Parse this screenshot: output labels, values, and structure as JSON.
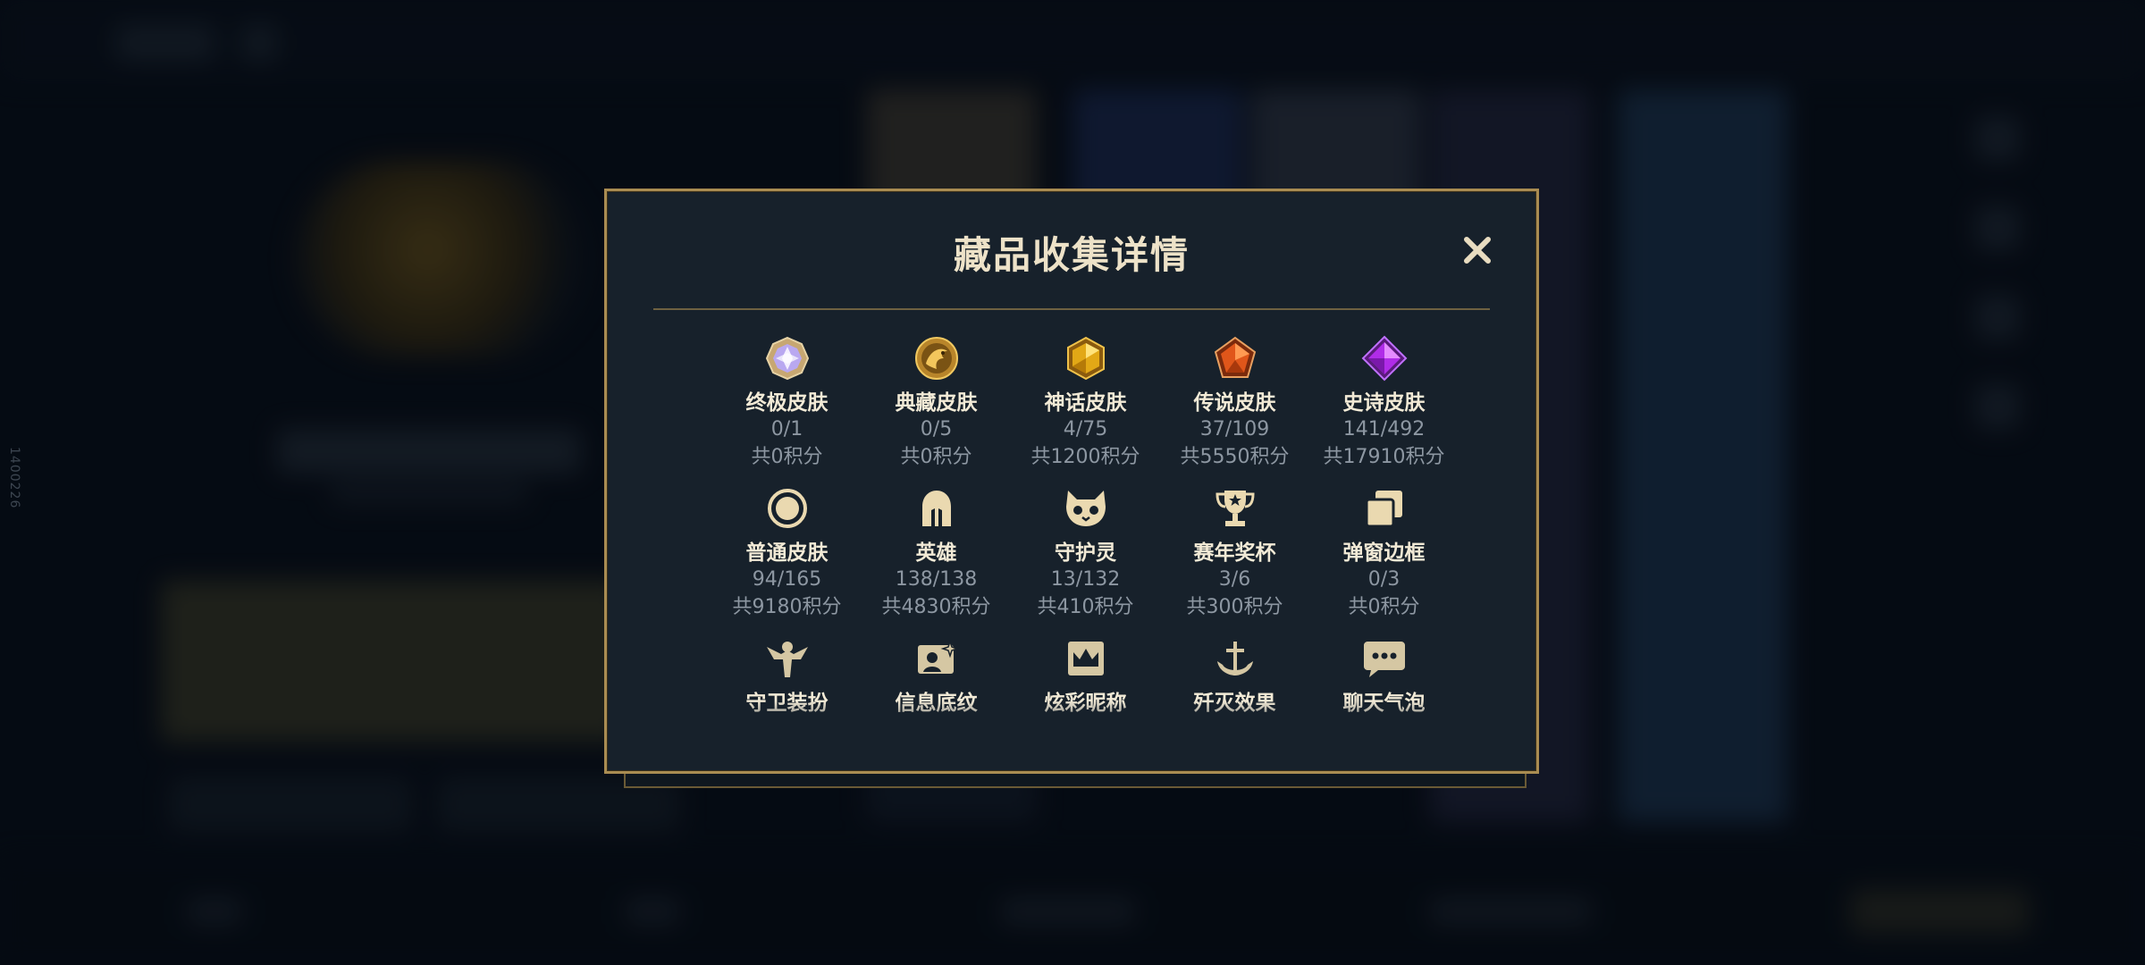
{
  "side_code": "1400226",
  "modal": {
    "title": "藏品收集详情",
    "close_icon": "close-icon"
  },
  "categories": [
    {
      "name": "终极皮肤",
      "count": "0/1",
      "points": "共0积分",
      "icon": "ultimate-gem-icon"
    },
    {
      "name": "典藏皮肤",
      "count": "0/5",
      "points": "共0积分",
      "icon": "dragon-medallion-icon"
    },
    {
      "name": "神话皮肤",
      "count": "4/75",
      "points": "共1200积分",
      "icon": "mythic-gem-icon"
    },
    {
      "name": "传说皮肤",
      "count": "37/109",
      "points": "共5550积分",
      "icon": "legendary-gem-icon"
    },
    {
      "name": "史诗皮肤",
      "count": "141/492",
      "points": "共17910积分",
      "icon": "epic-gem-icon"
    },
    {
      "name": "普通皮肤",
      "count": "94/165",
      "points": "共9180积分",
      "icon": "ring-icon"
    },
    {
      "name": "英雄",
      "count": "138/138",
      "points": "共4830积分",
      "icon": "helmet-icon"
    },
    {
      "name": "守护灵",
      "count": "13/132",
      "points": "共410积分",
      "icon": "guardian-face-icon"
    },
    {
      "name": "赛年奖杯",
      "count": "3/6",
      "points": "共300积分",
      "icon": "trophy-icon"
    },
    {
      "name": "弹窗边框",
      "count": "0/3",
      "points": "共0积分",
      "icon": "frame-stack-icon"
    },
    {
      "name": "守卫装扮",
      "icon": "ward-icon"
    },
    {
      "name": "信息底纹",
      "icon": "card-sparkle-icon"
    },
    {
      "name": "炫彩昵称",
      "icon": "crown-card-icon"
    },
    {
      "name": "歼灭效果",
      "icon": "anchor-icon"
    },
    {
      "name": "聊天气泡",
      "icon": "chat-bubble-icon"
    }
  ]
}
